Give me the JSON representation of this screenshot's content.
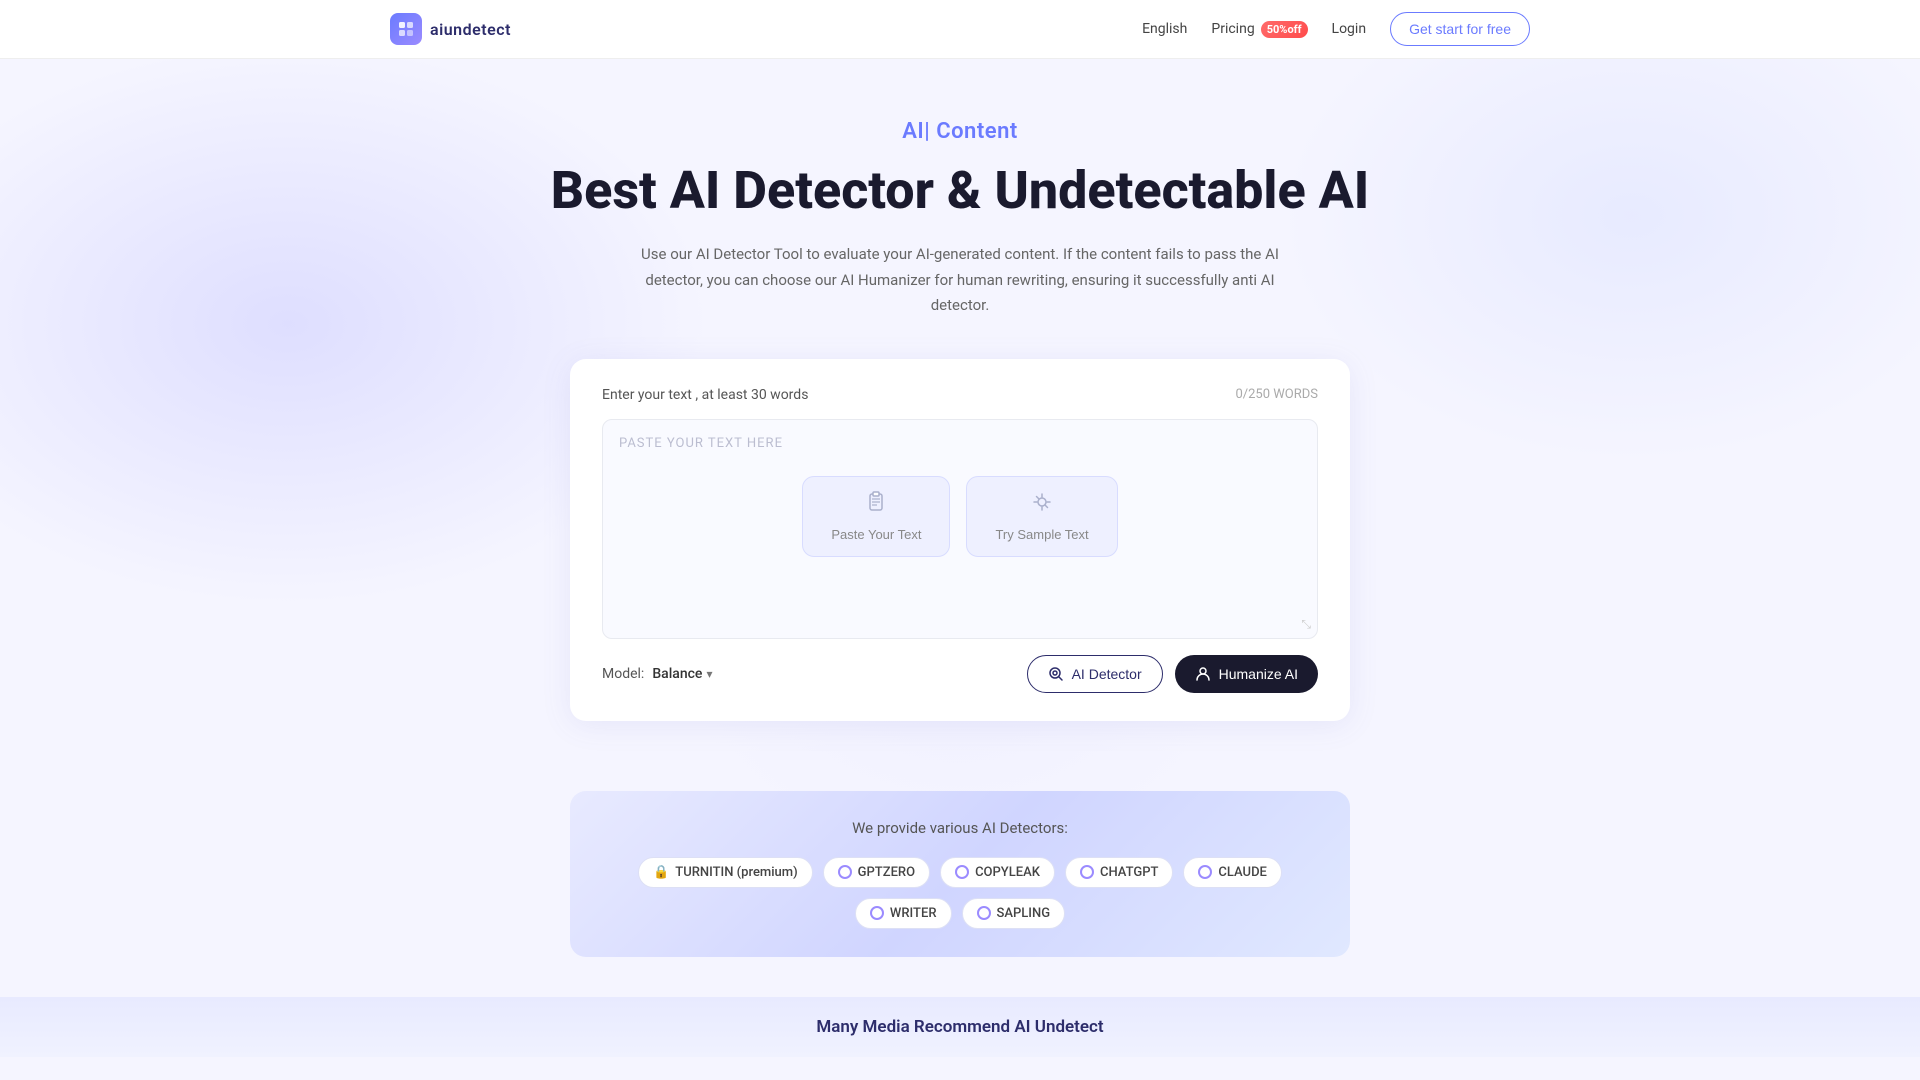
{
  "navbar": {
    "logo_text": "aiundetect",
    "logo_icon": "🔷",
    "nav_links": [
      {
        "label": "English",
        "id": "lang"
      },
      {
        "label": "Pricing",
        "id": "pricing"
      },
      {
        "label": "50%off",
        "id": "discount"
      },
      {
        "label": "Login",
        "id": "login"
      },
      {
        "label": "Get start for free",
        "id": "cta"
      }
    ]
  },
  "hero": {
    "subtitle": "AI| Content",
    "title": "Best AI Detector & Undetectable AI",
    "description": "Use our AI Detector Tool to evaluate your AI-generated content. If the content fails to pass the AI detector, you can choose our AI Humanizer for human rewriting, ensuring it successfully anti AI detector."
  },
  "card": {
    "label": "Enter your text , at least 30 words",
    "word_count": "0/250 WORDS",
    "placeholder": "PASTE YOUR TEXT HERE",
    "paste_btn_label": "Paste Your Text",
    "sample_btn_label": "Try Sample Text",
    "model_label": "Model:",
    "model_value": "Balance",
    "ai_detector_label": "AI Detector",
    "humanize_label": "Humanize AI"
  },
  "detectors": {
    "title": "We provide various AI Detectors:",
    "chips": [
      {
        "label": "TURNITIN (premium)",
        "type": "lock"
      },
      {
        "label": "GPTZERO",
        "type": "dot"
      },
      {
        "label": "COPYLEAK",
        "type": "dot"
      },
      {
        "label": "CHATGPT",
        "type": "dot"
      },
      {
        "label": "CLAUDE",
        "type": "dot"
      },
      {
        "label": "WRITER",
        "type": "dot"
      },
      {
        "label": "SAPLING",
        "type": "dot"
      }
    ]
  },
  "media": {
    "title": "Many Media Recommend AI Undetect"
  },
  "icons": {
    "paste": "📋",
    "sample": "✨",
    "detector": "🔍",
    "humanize": "🤖",
    "logo": "◈"
  }
}
